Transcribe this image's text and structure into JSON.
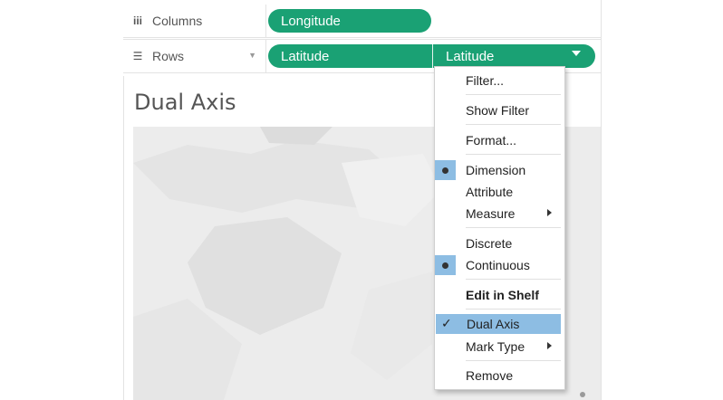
{
  "shelves": {
    "columns_label": "Columns",
    "rows_label": "Rows",
    "columns_pills": [
      "Longitude"
    ],
    "rows_pills": [
      "Latitude",
      "Latitude"
    ]
  },
  "sheet": {
    "title": "Dual Axis"
  },
  "context_menu": {
    "items": [
      {
        "label": "Filter..."
      },
      {
        "label": "Show Filter"
      },
      {
        "label": "Format..."
      },
      {
        "label": "Dimension",
        "selected": true
      },
      {
        "label": "Attribute"
      },
      {
        "label": "Measure",
        "submenu": true
      },
      {
        "label": "Discrete"
      },
      {
        "label": "Continuous",
        "selected": true
      },
      {
        "label": "Edit in Shelf",
        "bold": true
      },
      {
        "label": "Dual Axis",
        "checked": true,
        "highlighted": true
      },
      {
        "label": "Mark Type",
        "submenu": true
      },
      {
        "label": "Remove"
      }
    ]
  },
  "colors": {
    "pill": "#1aa174",
    "menu_highlight": "#8dbde3",
    "map_background": "#ececec"
  },
  "icons": {
    "columns": "columns-icon",
    "rows": "rows-icon"
  }
}
